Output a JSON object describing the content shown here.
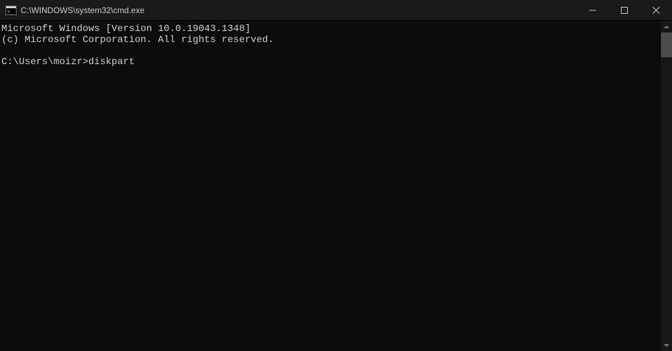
{
  "titlebar": {
    "title": "C:\\WINDOWS\\system32\\cmd.exe"
  },
  "terminal": {
    "lines": [
      "Microsoft Windows [Version 10.0.19043.1348]",
      "(c) Microsoft Corporation. All rights reserved.",
      "",
      "C:\\Users\\moizr>diskpart"
    ],
    "prompt": "C:\\Users\\moizr>",
    "command": "diskpart"
  }
}
